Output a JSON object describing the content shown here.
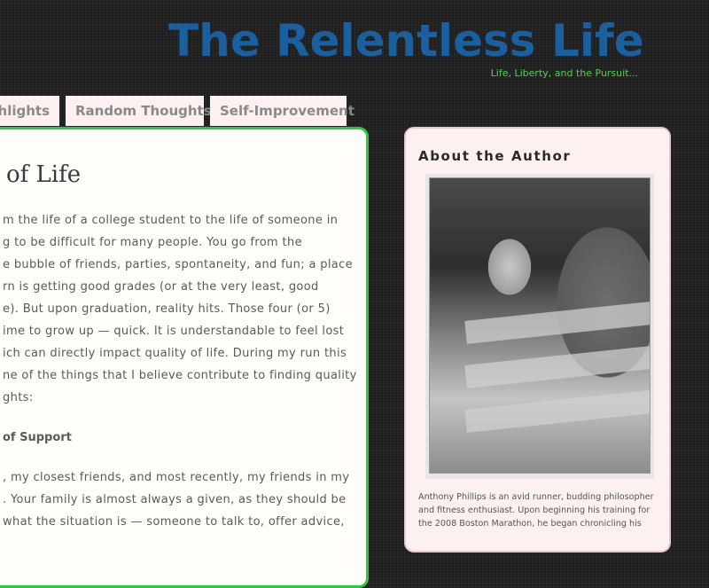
{
  "header": {
    "title": "The Relentless Life",
    "tagline": "Life, Liberty, and the Pursuit..."
  },
  "nav": {
    "tabs": [
      {
        "label": "ghlights"
      },
      {
        "label": "Random Thoughts"
      },
      {
        "label": "Self-Improvement"
      }
    ]
  },
  "post": {
    "title": "of Life",
    "lines": [
      "m the life of a college student to the life of someone in",
      "g to be difficult for many people.  You go from the",
      "e bubble of friends, parties, spontaneity, and fun; a place",
      "rn is getting good grades (or at the very least, good",
      "e).  But upon graduation, reality hits.  Those four (or 5)",
      "ime to grow up — quick.  It is understandable to feel lost",
      "ich can directly impact quality of life.  During my run this",
      "ne of the things that I believe contribute to finding quality",
      "ghts:"
    ],
    "subheading": "of Support",
    "lines2": [
      ", my closest friends, and most recently, my friends in my",
      ".  Your family is almost always a given, as they should be",
      "what the situation is — someone to talk to, offer advice,"
    ]
  },
  "sidebar": {
    "heading": "About the Author",
    "photo_icon": "author-photo",
    "bio": "Anthony Phillips is an avid runner, budding philosopher and fitness enthusiast. Upon beginning his training for the 2008 Boston Marathon, he began chronicling his"
  },
  "colors": {
    "title": "#1a5f9e",
    "tagline": "#4cd24c",
    "post_border": "#2ec93a",
    "tab_bg": "#fdf0f0"
  }
}
